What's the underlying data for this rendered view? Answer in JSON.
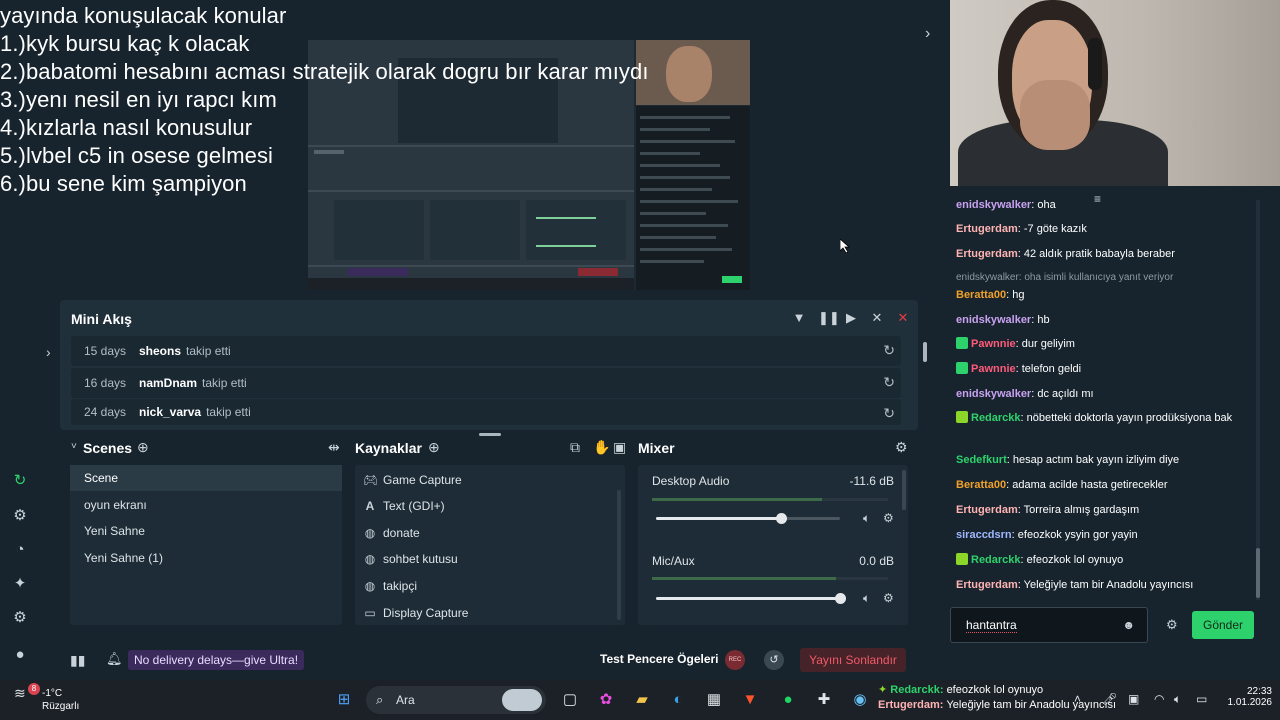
{
  "overlay": {
    "lines": [
      "yayında konuşulacak konular",
      "1.)kyk bursu kaç k olacak",
      "2.)babatomi hesabını acması stratejik olarak dogru bır karar mıydı",
      "3.)yenı nesil en iyı rapcı kım",
      "4.)kızlarla nasıl konusulur",
      "5.)lvbel c5 in osese gelmesi",
      "6.)bu sene kim şampiyon"
    ]
  },
  "mini_akis": {
    "title": "Mini Akış",
    "events": [
      {
        "time": "15 days",
        "user": "sheons",
        "action": "takip etti"
      },
      {
        "time": "16 days",
        "user": "namDnam",
        "action": "takip etti"
      },
      {
        "time": "24 days",
        "user": "nick_varva",
        "action": "takip etti"
      }
    ]
  },
  "scenes": {
    "title": "Scenes",
    "items": [
      "Scene",
      "oyun ekranı",
      "Yeni Sahne",
      "Yeni Sahne (1)"
    ],
    "active_index": 0
  },
  "sources": {
    "title": "Kaynaklar",
    "items": [
      {
        "icon": "gamepad-icon",
        "label": "Game Capture"
      },
      {
        "icon": "text-icon",
        "label": "Text (GDI+)"
      },
      {
        "icon": "globe-icon",
        "label": "donate"
      },
      {
        "icon": "globe-icon",
        "label": "sohbet kutusu"
      },
      {
        "icon": "globe-icon",
        "label": "takipçi"
      },
      {
        "icon": "monitor-icon",
        "label": "Display Capture"
      }
    ]
  },
  "mixer": {
    "title": "Mixer",
    "channels": [
      {
        "name": "Desktop Audio",
        "db": "-11.6 dB",
        "level": 0.68,
        "meter": 0.72
      },
      {
        "name": "Mic/Aux",
        "db": "0.0 dB",
        "level": 1.0,
        "meter": 0.78
      }
    ]
  },
  "statusbar": {
    "promo": "No delivery delays—give Ultra!",
    "test_label": "Test Pencere Ögeleri",
    "rec_label": "REC",
    "end_stream": "Yayını Sonlandır"
  },
  "chat": {
    "messages": [
      {
        "user": "enidskywalker",
        "color": "#c8a2f0",
        "text": "oha",
        "badge": null
      },
      {
        "user": "Ertugerdam",
        "color": "#ffb3b3",
        "text": "-7 göte kazık",
        "badge": null
      },
      {
        "user": "Ertugerdam",
        "color": "#ffb3b3",
        "text": "42 aldık pratik babayla beraber",
        "badge": null
      },
      {
        "user": "Beratta00",
        "color": "#f0a02a",
        "text": "hg",
        "badge": null
      },
      {
        "user": "enidskywalker",
        "color": "#c8a2f0",
        "text": "hb",
        "badge": null
      },
      {
        "user": "Pawnnie",
        "color": "#ff5a7a",
        "text": "dur geliyim",
        "badge": "#2ed26c"
      },
      {
        "user": "Pawnnie",
        "color": "#ff5a7a",
        "text": "telefon geldi",
        "badge": "#2ed26c"
      },
      {
        "user": "enidskywalker",
        "color": "#c8a2f0",
        "text": "dc açıldı mı",
        "badge": null
      },
      {
        "user": "Redarckk",
        "color": "#2ed26c",
        "text": "nöbetteki doktorla yayın prodüksiyona bak",
        "badge": "#8cd62a"
      },
      {
        "user": "Sedefkurt",
        "color": "#2ed26c",
        "text": "hesap actım bak yayın izliyim diye",
        "badge": null
      },
      {
        "user": "Beratta00",
        "color": "#f0a02a",
        "text": "adama acilde hasta getirecekler",
        "badge": null
      },
      {
        "user": "Ertugerdam",
        "color": "#ffb3b3",
        "text": "Torreira almış gardaşım",
        "badge": null
      },
      {
        "user": "siraccdsrn",
        "color": "#9fb8ff",
        "text": "efeozkok ysyin gor yayin",
        "badge": null
      },
      {
        "user": "Redarckk",
        "color": "#2ed26c",
        "text": "efeozkok lol oynuyo",
        "badge": "#8cd62a"
      },
      {
        "user": "Ertugerdam",
        "color": "#ffb3b3",
        "text": "Yeleğiyle tam bir Anadolu yayıncısı",
        "badge": null
      }
    ],
    "reply_note": "enidskywalker: oha isimli kullanıcıya yanıt veriyor",
    "input_value": "hantantra",
    "send_label": "Gönder"
  },
  "taskbar": {
    "weather_temp": "-1°C",
    "weather_desc": "Rüzgarlı",
    "weather_badge": "8",
    "search_label": "Ara",
    "ticker_user1": "Redarckk",
    "ticker_text1": "efeozkok lol oynuyo",
    "ticker_user2": "Ertugerdam",
    "ticker_text2": "Yeleğiyle tam bir Anadolu yayıncısı",
    "time": "22:33",
    "date": "1.01.2026"
  }
}
